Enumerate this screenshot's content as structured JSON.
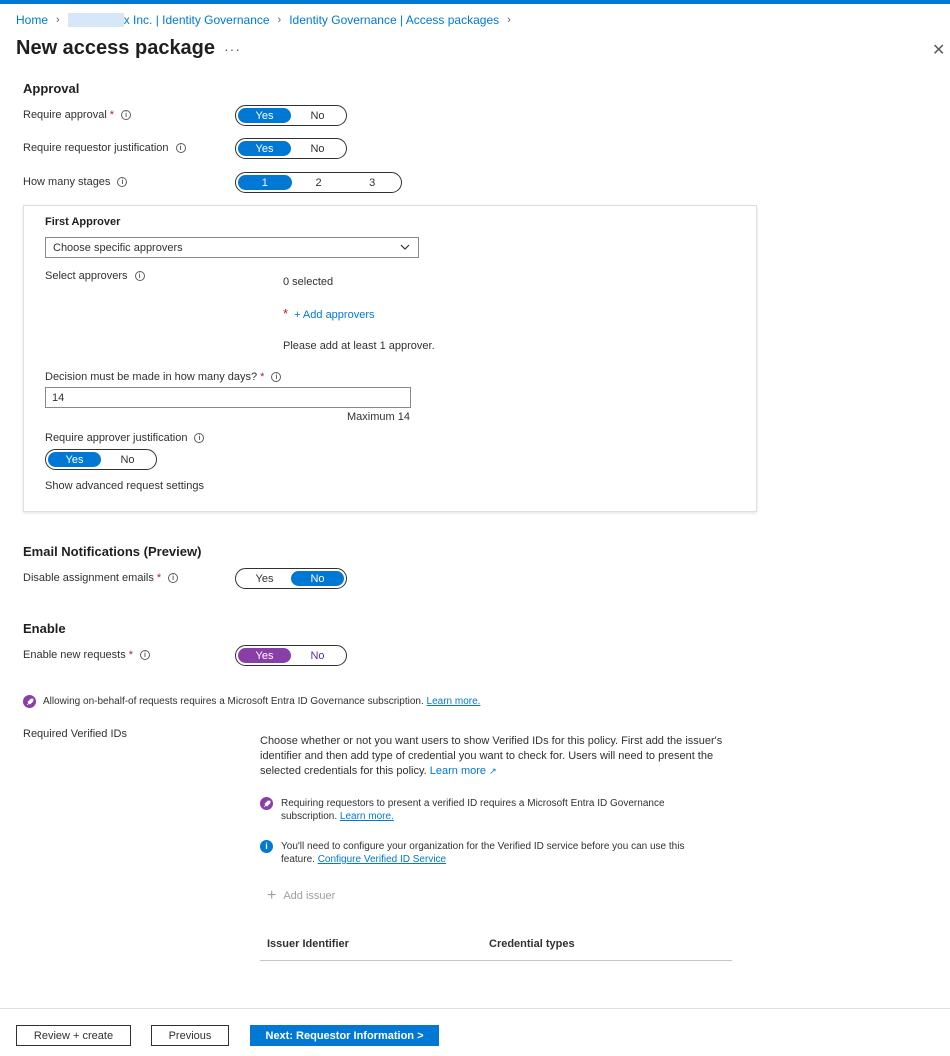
{
  "breadcrumb": {
    "home": "Home",
    "org": "x Inc. | Identity Governance",
    "section": "Identity Governance | Access packages"
  },
  "page_title": "New access package",
  "approval": {
    "title": "Approval",
    "require_approval": {
      "label": "Require approval",
      "options": [
        "Yes",
        "No"
      ],
      "selected": "Yes"
    },
    "require_justification": {
      "label": "Require requestor justification",
      "options": [
        "Yes",
        "No"
      ],
      "selected": "Yes"
    },
    "stages": {
      "label": "How many stages",
      "options": [
        "1",
        "2",
        "3"
      ],
      "selected": "1"
    }
  },
  "first_approver": {
    "title": "First Approver",
    "dropdown_value": "Choose specific approvers",
    "select_label": "Select approvers",
    "selected_count": "0 selected",
    "add_link": "+ Add approvers",
    "error": "Please add at least 1 approver.",
    "decision_label": "Decision must be made in how many days?",
    "decision_value": "14",
    "maximum": "Maximum 14",
    "approver_justification": {
      "label": "Require approver justification",
      "options": [
        "Yes",
        "No"
      ],
      "selected": "Yes"
    },
    "advanced_link": "Show advanced request settings"
  },
  "email": {
    "title": "Email Notifications (Preview)",
    "disable_emails": {
      "label": "Disable assignment emails",
      "options": [
        "Yes",
        "No"
      ],
      "selected": "No"
    }
  },
  "enable": {
    "title": "Enable",
    "enable_requests": {
      "label": "Enable new requests",
      "options": [
        "Yes",
        "No"
      ],
      "selected": "Yes"
    },
    "behalf_notice": "Allowing on-behalf-of requests requires a Microsoft Entra ID Governance subscription.",
    "behalf_learn": "Learn more."
  },
  "verified_ids": {
    "label": "Required Verified IDs",
    "description": "Choose whether or not you want users to show Verified IDs for this policy. First add the issuer's identifier and then add type of credential you want to check for. Users will need to present the selected credentials for this policy.",
    "learn_more": "Learn more",
    "notice1": "Requiring requestors to present a verified ID requires a Microsoft Entra ID Governance subscription.",
    "notice1_learn": "Learn more.",
    "notice2": "You'll need to configure your organization for the Verified ID service before you can use this feature.",
    "notice2_link": "Configure Verified ID Service",
    "add_issuer": "Add issuer",
    "columns": [
      "Issuer Identifier",
      "Credential types"
    ]
  },
  "footer": {
    "review": "Review + create",
    "previous": "Previous",
    "next": "Next: Requestor Information >"
  },
  "colors": {
    "accent": "#0078d4",
    "purple": "#8a3ea8",
    "error": "#a4262c"
  }
}
